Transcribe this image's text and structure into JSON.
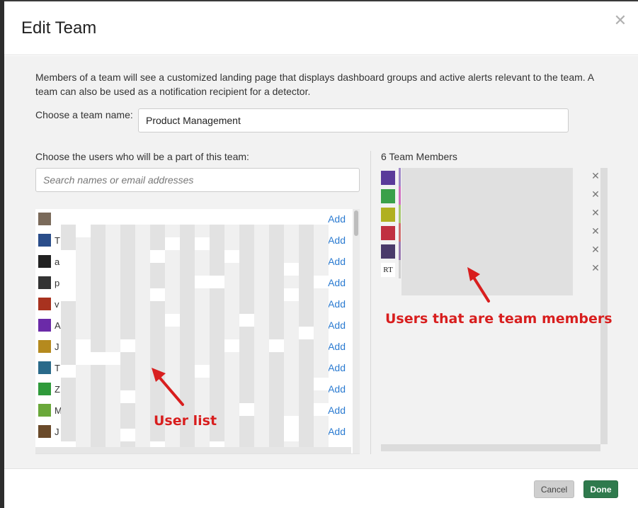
{
  "modal": {
    "title": "Edit Team",
    "close_icon": "close-icon"
  },
  "form": {
    "description": "Members of a team will see a customized landing page that displays dashboard groups and active alerts relevant to the team. A team can also be used as a notification recipient for a detector.",
    "team_name_label": "Choose a team name:",
    "team_name_value": "Product Management",
    "users_label": "Choose the users who will be a part of this team:",
    "search_placeholder": "Search names or email addresses"
  },
  "user_list": {
    "add_label": "Add",
    "rows": [
      {
        "initial": "",
        "avatar_color": "#7a6a5a"
      },
      {
        "initial": "T",
        "avatar_color": "#2a4d8a"
      },
      {
        "initial": "a",
        "avatar_color": "#222222"
      },
      {
        "initial": "p",
        "avatar_color": "#333333"
      },
      {
        "initial": "v",
        "avatar_color": "#a8321f"
      },
      {
        "initial": "A",
        "avatar_color": "#6b2aa8"
      },
      {
        "initial": "J",
        "avatar_color": "#b58a1e"
      },
      {
        "initial": "T",
        "avatar_color": "#2a6a8a"
      },
      {
        "initial": "Z",
        "avatar_color": "#2f9a3a"
      },
      {
        "initial": "M",
        "avatar_color": "#6aa83a"
      },
      {
        "initial": "J",
        "avatar_color": "#6a4a2a"
      }
    ]
  },
  "members": {
    "header": "6 Team Members",
    "rows": [
      {
        "avatar_color": "#5a3a9a",
        "bar_color": "#a08ac8"
      },
      {
        "avatar_color": "#3aa04a",
        "bar_color": "#d070c0"
      },
      {
        "avatar_color": "#b0b020",
        "bar_color": "#a8c870"
      },
      {
        "avatar_color": "#c03040",
        "bar_color": "#d07070"
      },
      {
        "avatar_color": "#4a3a6a",
        "bar_color": "#9a7ab0"
      },
      {
        "avatar_color": "#ffffff",
        "bar_color": "#d0d0d0",
        "avatar_text": "RT"
      }
    ]
  },
  "annotations": {
    "user_list": "User list",
    "team_members": "Users that are  team members"
  },
  "footer": {
    "cancel_label": "Cancel",
    "done_label": "Done"
  },
  "colors": {
    "accent_link": "#2b7bd1",
    "done_button": "#2f7a4d",
    "annotation_red": "#d81e1e"
  }
}
